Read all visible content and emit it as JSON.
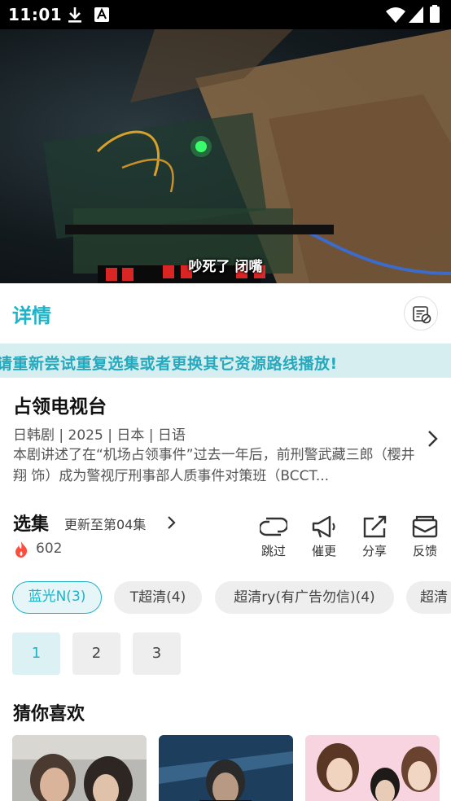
{
  "status_bar": {
    "time": "11:01",
    "icons": [
      "download-icon",
      "a-badge-icon",
      "wifi-icon",
      "signal-icon",
      "battery-icon"
    ]
  },
  "player": {
    "subtitle": "吵死了 闭嘴"
  },
  "detail_header": {
    "title": "详情",
    "icon": "document-settings-icon"
  },
  "notice": {
    "text": "请重新尝试重复选集或者更换其它资源路线播放!"
  },
  "show": {
    "title": "占领电视台",
    "meta": "日韩剧 | 2025 | 日本 | 日语",
    "description": "本剧讲述了在“机场占领事件”过去一年后，前刑警武藏三郎（樱井翔 饰）成为警视厅刑事部人质事件对策班（BCCT..."
  },
  "episodes": {
    "label": "选集",
    "update_text": "更新至第04集",
    "heat_count": "602",
    "actions": [
      {
        "name": "skip",
        "label": "跳过",
        "icon": "skip-icon"
      },
      {
        "name": "urge",
        "label": "催更",
        "icon": "megaphone-icon"
      },
      {
        "name": "share",
        "label": "分享",
        "icon": "share-icon"
      },
      {
        "name": "feedback",
        "label": "反馈",
        "icon": "mail-icon"
      }
    ],
    "sources": [
      {
        "label": "蓝光N(3)",
        "active": true
      },
      {
        "label": "T超清(4)",
        "active": false
      },
      {
        "label": "超清ry(有广告勿信)(4)",
        "active": false
      },
      {
        "label": "超清",
        "active": false
      }
    ],
    "list": [
      {
        "label": "1",
        "active": true
      },
      {
        "label": "2",
        "active": false
      },
      {
        "label": "3",
        "active": false
      }
    ]
  },
  "recommend": {
    "title": "猜你喜欢"
  },
  "colors": {
    "accent": "#1eb3c8",
    "notice_bg": "#d7eef1",
    "chip_bg": "#eeeeee",
    "heat": "#ff4d3d"
  }
}
